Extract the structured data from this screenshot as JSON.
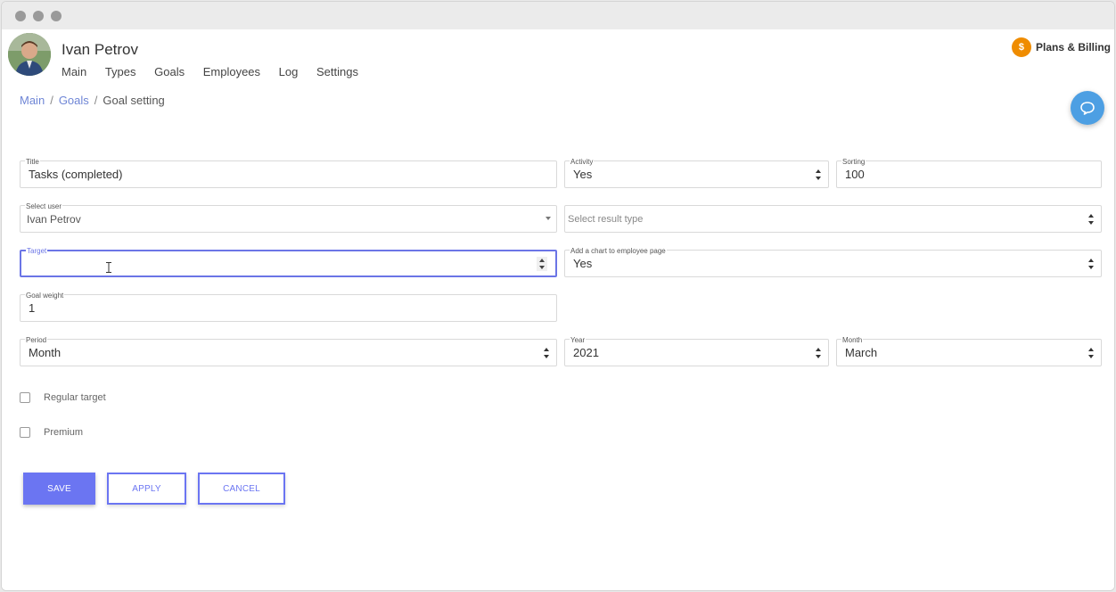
{
  "header": {
    "user_name": "Ivan Petrov",
    "nav": [
      "Main",
      "Types",
      "Goals",
      "Employees",
      "Log",
      "Settings"
    ],
    "plans_label": "Plans & Billing",
    "plans_icon_glyph": "$"
  },
  "breadcrumb": {
    "items": [
      "Main",
      "Goals"
    ],
    "current": "Goal setting"
  },
  "form": {
    "title": {
      "label": "Title",
      "value": "Tasks (completed)"
    },
    "activity": {
      "label": "Activity",
      "value": "Yes"
    },
    "sorting": {
      "label": "Sorting",
      "value": "100"
    },
    "select_user": {
      "label": "Select user",
      "value": "Ivan Petrov"
    },
    "result_type": {
      "placeholder": "Select result type"
    },
    "target": {
      "label": "Target",
      "value": ""
    },
    "add_chart": {
      "label": "Add a chart to employee page",
      "value": "Yes"
    },
    "goal_weight": {
      "label": "Goal weight",
      "value": "1"
    },
    "period": {
      "label": "Period",
      "value": "Month"
    },
    "year": {
      "label": "Year",
      "value": "2021"
    },
    "month": {
      "label": "Month",
      "value": "March"
    },
    "regular_target": {
      "label": "Regular target",
      "checked": false
    },
    "premium": {
      "label": "Premium",
      "checked": false
    }
  },
  "buttons": {
    "save": "SAVE",
    "apply": "APPLY",
    "cancel": "CANCEL"
  },
  "colors": {
    "accent": "#6b75f2",
    "link": "#6f86d6",
    "chat": "#4d9fe3",
    "coin": "#ef8c00"
  }
}
